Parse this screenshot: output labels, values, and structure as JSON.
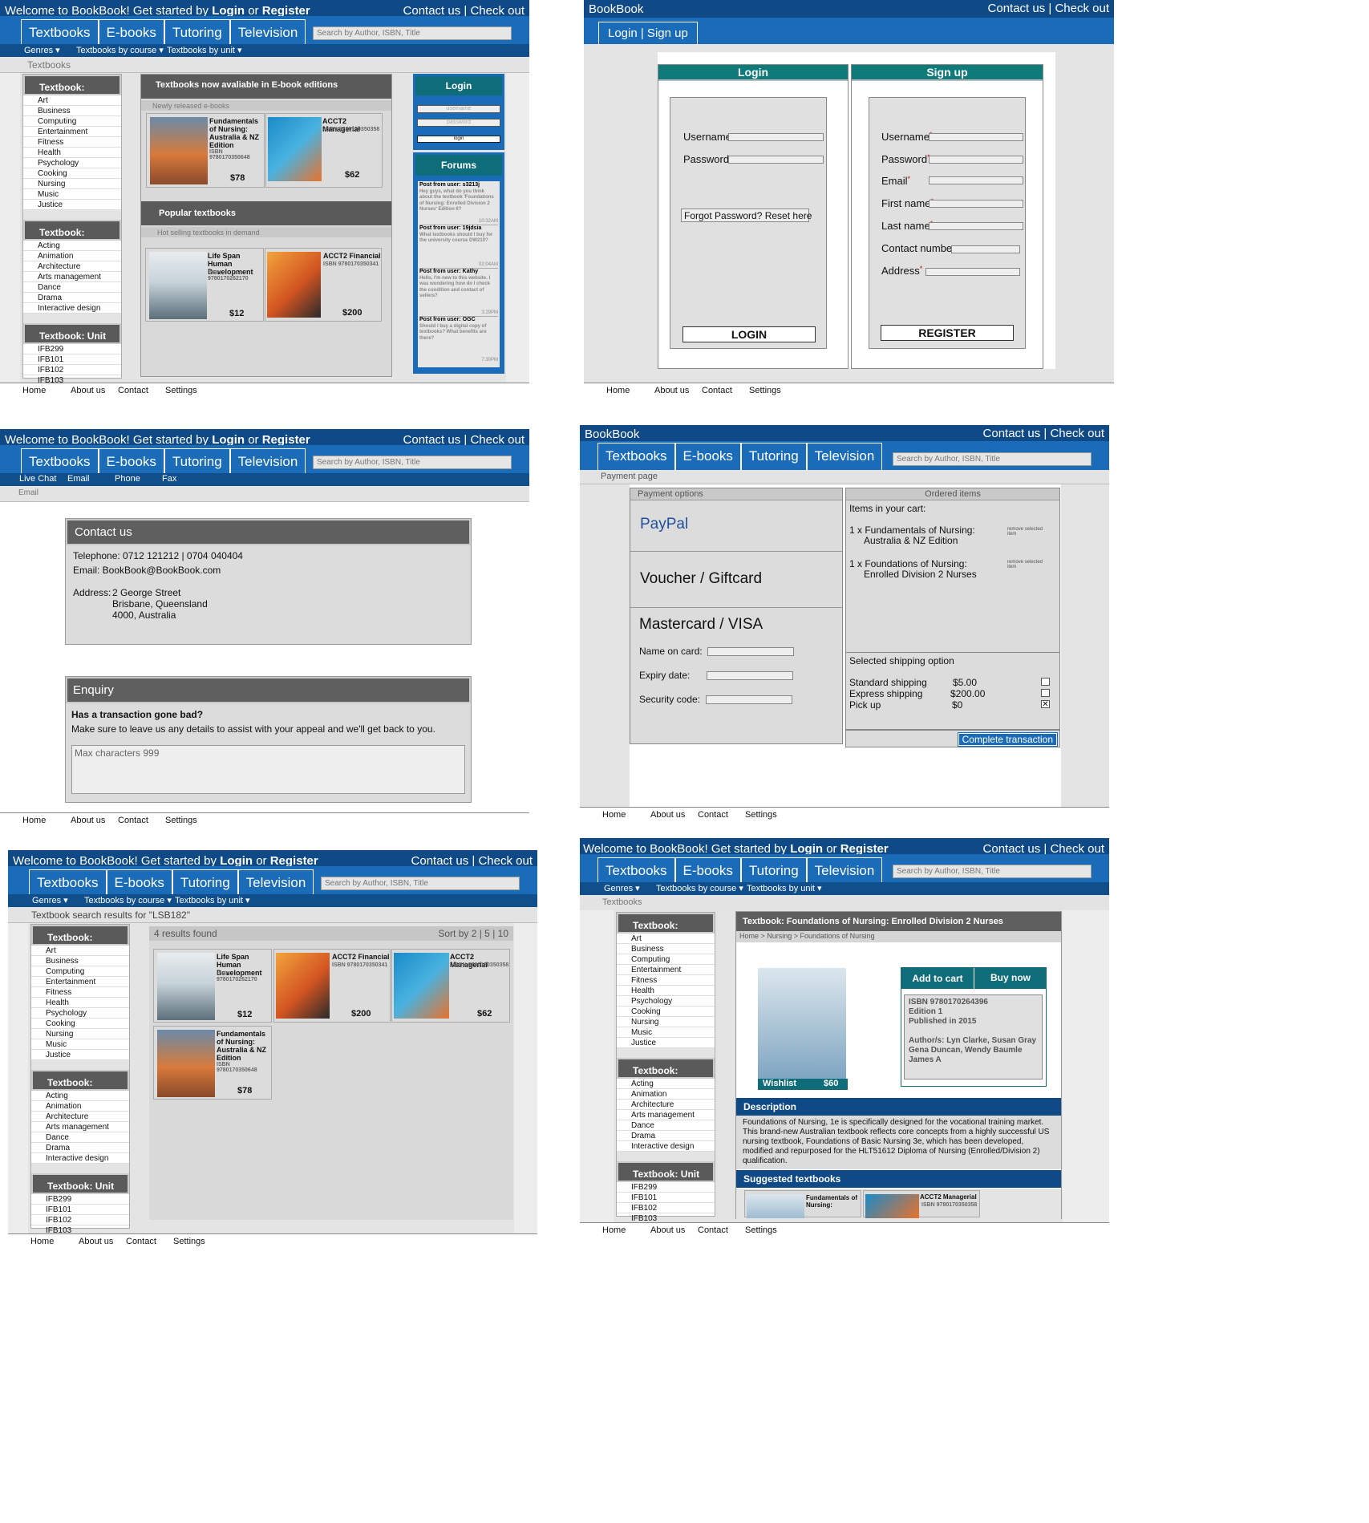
{
  "common": {
    "welcome": "Welcome to BookBook!",
    "get_started": "Get started by",
    "login": "Login",
    "or": "or",
    "register": "Register",
    "contact_checkout": "Contact us | Check out",
    "brand": "BookBook",
    "tabs": [
      "Textbooks",
      "E-books",
      "Tutoring",
      "Television"
    ],
    "search_placeholder": "Search by Author, ISBN, Title",
    "sub_genres": "Genres ▾",
    "sub_course": "Textbooks by course ▾",
    "sub_unit": "Textbooks by unit ▾",
    "footer": [
      "Home",
      "About us",
      "Contact",
      "Settings"
    ]
  },
  "sidebar": {
    "genres_title": "Textbook: Genres",
    "genres": [
      "Art",
      "Business",
      "Computing",
      "Entertainment",
      "Fitness",
      "Health",
      "Psychology",
      "Cooking",
      "Nursing",
      "Music",
      "Justice"
    ],
    "course_title": "Textbook: Course",
    "courses": [
      "Acting",
      "Animation",
      "Architecture",
      "Arts management",
      "Dance",
      "Drama",
      "Interactive design"
    ],
    "unit_title": "Textbook: Unit",
    "units": [
      "IFB299",
      "IFB101",
      "IFB102",
      "IFB103"
    ]
  },
  "books": {
    "nursing_au": {
      "title": "Fundamentals of Nursing: Australia & NZ Edition",
      "isbn": "ISBN 9780170350648",
      "price": "$78"
    },
    "acct2_man": {
      "title": "ACCT2 Managerial",
      "isbn": "ISBN 9780170350358",
      "price": "$62"
    },
    "lifespan": {
      "title": "Life Span Human Development",
      "isbn": "ISBN 9780170262170",
      "price": "$12"
    },
    "acct2_fin": {
      "title": "ACCT2 Financial",
      "isbn": "ISBN 9780170350341",
      "price": "$200"
    }
  },
  "home": {
    "crumb": "Textbooks",
    "ebook_head": "Textbooks now avaliable in E-book editions",
    "ebook_sub": "Newly released e-books",
    "popular_head": "Popular textbooks",
    "popular_sub": "Hot selling textbooks in demand",
    "login_title": "Login",
    "username_ph": "username",
    "password_ph": "password",
    "login_btn": "login",
    "forums_title": "Forums",
    "posts": [
      {
        "user": "Post from user: s3213j",
        "text": "Hey guys, what do you think about the textbook 'Foundations of Nursing: Enrolled Division 2 Nurses' Edition 6?",
        "time": "10:32AM"
      },
      {
        "user": "Post from user: 19jdsia",
        "text": "What textbooks should I buy for the university course DW210?",
        "time": "02:04AM"
      },
      {
        "user": "Post from user: Kathy",
        "text": "Hello, I'm new to this website. I was wondering how do I check the condition and contact of sellers?",
        "time": "3:29PM"
      },
      {
        "user": "Post from user: OGC",
        "text": "Should I buy a digital copy of textbooks? What benefits are there?",
        "time": "7:30PM"
      }
    ]
  },
  "auth": {
    "tab": "Login | Sign up",
    "login_head": "Login",
    "signup_head": "Sign up",
    "username": "Username",
    "password": "Password",
    "forgot": "Forgot Password? Reset here",
    "login_btn": "LOGIN",
    "su_fields": [
      "Username",
      "Password",
      "Email",
      "First name",
      "Last name",
      "Contact number",
      "Address"
    ],
    "register_btn": "REGISTER"
  },
  "contact": {
    "sub": [
      "Live Chat",
      "Email",
      "Phone",
      "Fax"
    ],
    "crumb": "Email",
    "head": "Contact us",
    "phone": "Telephone: 0712 121212 | 0704 040404",
    "email": "Email: BookBook@BookBook.com",
    "addr_label": "Address:",
    "addr1": "2 George Street",
    "addr2": "Brisbane, Queensland",
    "addr3": "4000, Australia",
    "enq_head": "Enquiry",
    "enq_q": "Has a transaction gone bad?",
    "enq_text": "Make sure to leave us any details to assist with your appeal and we'll get back to you.",
    "enq_ph": "Max characters 999"
  },
  "payment": {
    "crumb": "Payment page",
    "opts_head": "Payment options",
    "paypal": "PayPal",
    "voucher": "Voucher / Giftcard",
    "card": "Mastercard / VISA",
    "name": "Name on card:",
    "expiry": "Expiry date:",
    "security": "Security code:",
    "ordered_head": "Ordered items",
    "cart": "Items in your cart:",
    "item1a": "1 x Fundamentals of Nursing:",
    "item1b": "Australia & NZ Edition",
    "item2a": "1 x Foundations of Nursing:",
    "item2b": "Enrolled Division 2 Nurses",
    "remove": "remove selected item",
    "ship_head": "Selected shipping option",
    "ship": [
      {
        "name": "Standard shipping",
        "price": "$5.00"
      },
      {
        "name": "Express shipping",
        "price": "$200.00"
      },
      {
        "name": "Pick up",
        "price": "$0"
      }
    ],
    "complete": "Complete transaction"
  },
  "results": {
    "crumb": "Textbook search results for \"LSB182\"",
    "found": "4 results found",
    "sort": "Sort by 2 | 5 | 10"
  },
  "detail": {
    "head": "Textbook:  Foundations of Nursing: Enrolled Division 2 Nurses",
    "crumb": "Home > Nursing > Foundations of Nursing",
    "add": "Add to cart",
    "buy": "Buy now",
    "wishlist": "Wishlist",
    "price": "$60",
    "isbn": "ISBN 9780170264396",
    "edition": "Edition 1",
    "published": "Published in 2015",
    "authors": "Author/s: Lyn Clarke, Susan Gray Gena Duncan, Wendy Baumle James A",
    "desc_head": "Description",
    "desc": "Foundations of Nursing, 1e is specifically designed for the vocational training market. This brand-new Australian textbook reflects core concepts from a highly successful US nursing textbook, Foundations of Basic Nursing 3e, which has been developed, modified and repurposed for the HLT51612 Diploma of Nursing (Enrolled/Division 2) qualification.",
    "suggest_head": "Suggested textbooks",
    "sug1": "Fundamentals of Nursing:",
    "sug2": "ACCT2 Managerial",
    "sug2_isbn": "ISBN 9780170350358"
  }
}
